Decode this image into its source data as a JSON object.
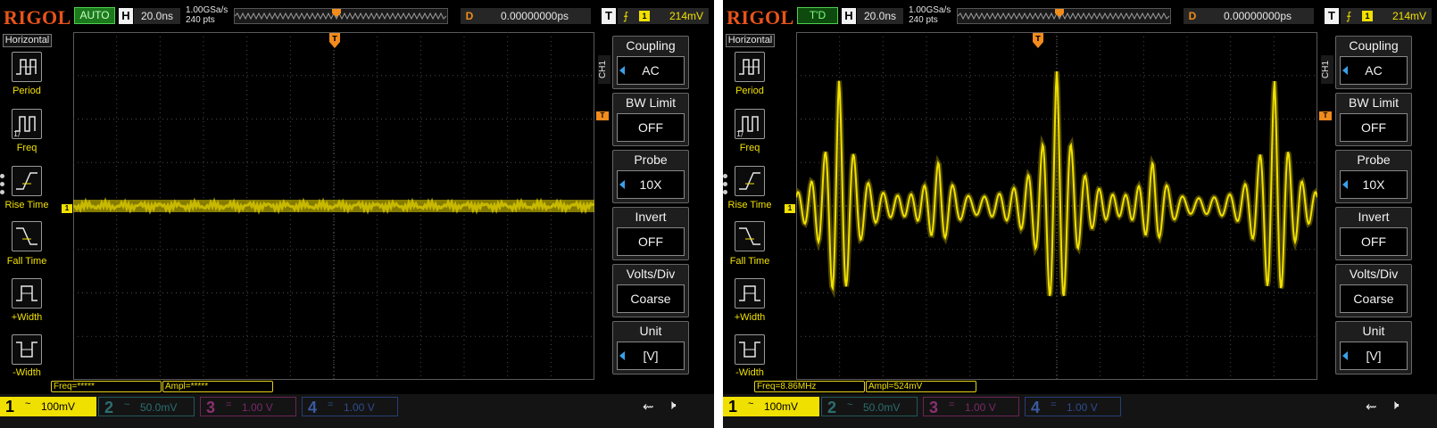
{
  "brand": "RIGOL",
  "colors": {
    "ch1": "#f0e000",
    "ch2": "#2d6e70",
    "ch3": "#8a3070",
    "ch4": "#3a5aa0",
    "trigger": "#f28c1c",
    "auto_status": "#1c7a1c"
  },
  "screens": [
    {
      "status": "AUTO",
      "horizontal": {
        "label": "H",
        "timebase": "20.0ns",
        "sample_rate": "1.00GSa/s",
        "points": "240 pts"
      },
      "delay": {
        "label": "D",
        "value": "0.00000000ps"
      },
      "trigger": {
        "label": "T",
        "slope_icon": "rising-edge-icon",
        "source": "1",
        "level": "214mV"
      },
      "left_menu": {
        "title": "Horizontal",
        "items": [
          {
            "label": "Period",
            "icon": "period-icon"
          },
          {
            "label": "Freq",
            "icon": "freq-icon"
          },
          {
            "label": "Rise Time",
            "icon": "rise-time-icon"
          },
          {
            "label": "Fall Time",
            "icon": "fall-time-icon"
          },
          {
            "label": "+Width",
            "icon": "pos-width-icon"
          },
          {
            "label": "-Width",
            "icon": "neg-width-icon"
          }
        ]
      },
      "channel_tab": "CH1",
      "ch1_marker": "1",
      "trigger_marker": "T",
      "right_menu": [
        {
          "title": "Coupling",
          "value": "AC",
          "arrow": true
        },
        {
          "title": "BW Limit",
          "value": "OFF",
          "arrow": false
        },
        {
          "title": "Probe",
          "value": "10X",
          "arrow": true
        },
        {
          "title": "Invert",
          "value": "OFF",
          "arrow": false
        },
        {
          "title": "Volts/Div",
          "value": "Coarse",
          "arrow": false
        },
        {
          "title": "Unit",
          "value": "[V]",
          "arrow": true
        }
      ],
      "measurements": {
        "freq": "Freq=*****",
        "ampl": "Ampl=*****"
      },
      "channels": [
        {
          "num": "1",
          "coupling": "~",
          "scale": "100mV",
          "active": true
        },
        {
          "num": "2",
          "coupling": "~",
          "scale": "50.0mV",
          "active": false
        },
        {
          "num": "3",
          "coupling": "=",
          "scale": "1.00 V",
          "active": false
        },
        {
          "num": "4",
          "coupling": "=",
          "scale": "1.00 V",
          "active": false
        }
      ],
      "waveform": "flat"
    },
    {
      "status": "T'D",
      "horizontal": {
        "label": "H",
        "timebase": "20.0ns",
        "sample_rate": "1.00GSa/s",
        "points": "240 pts"
      },
      "delay": {
        "label": "D",
        "value": "0.00000000ps"
      },
      "trigger": {
        "label": "T",
        "slope_icon": "rising-edge-icon",
        "source": "1",
        "level": "214mV"
      },
      "left_menu": {
        "title": "Horizontal",
        "items": [
          {
            "label": "Period",
            "icon": "period-icon"
          },
          {
            "label": "Freq",
            "icon": "freq-icon"
          },
          {
            "label": "Rise Time",
            "icon": "rise-time-icon"
          },
          {
            "label": "Fall Time",
            "icon": "fall-time-icon"
          },
          {
            "label": "+Width",
            "icon": "pos-width-icon"
          },
          {
            "label": "-Width",
            "icon": "neg-width-icon"
          }
        ]
      },
      "channel_tab": "CH1",
      "ch1_marker": "1",
      "trigger_marker": "T",
      "right_menu": [
        {
          "title": "Coupling",
          "value": "AC",
          "arrow": true
        },
        {
          "title": "BW Limit",
          "value": "OFF",
          "arrow": false
        },
        {
          "title": "Probe",
          "value": "10X",
          "arrow": true
        },
        {
          "title": "Invert",
          "value": "OFF",
          "arrow": false
        },
        {
          "title": "Volts/Div",
          "value": "Coarse",
          "arrow": false
        },
        {
          "title": "Unit",
          "value": "[V]",
          "arrow": true
        }
      ],
      "measurements": {
        "freq": "Freq=8.86MHz",
        "ampl": "Ampl=524mV"
      },
      "channels": [
        {
          "num": "1",
          "coupling": "~",
          "scale": "100mV",
          "active": true
        },
        {
          "num": "2",
          "coupling": "~",
          "scale": "50.0mV",
          "active": false
        },
        {
          "num": "3",
          "coupling": "=",
          "scale": "1.00 V",
          "active": false
        },
        {
          "num": "4",
          "coupling": "=",
          "scale": "1.00 V",
          "active": false
        }
      ],
      "waveform": "ringing"
    }
  ]
}
